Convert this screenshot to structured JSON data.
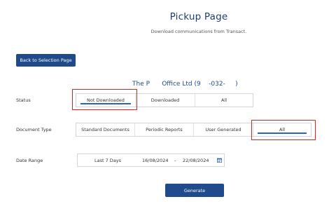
{
  "page": {
    "title": "Pickup Page",
    "subtitle": "Download communications from Transact."
  },
  "back_button": {
    "label": "Back to Selection Page"
  },
  "company": {
    "name": "The P      Office Ltd (9    -032-     )"
  },
  "status": {
    "label": "Status",
    "options": [
      "Not Downloaded",
      "Downloaded",
      "All"
    ],
    "selected": "Not Downloaded"
  },
  "document_type": {
    "label": "Document Type",
    "options": [
      "Standard Documents",
      "Periodic Reports",
      "User Generated",
      "All"
    ],
    "selected": "All"
  },
  "date_range": {
    "label": "Date Range",
    "preset": "Last 7 Days",
    "from": "16/08/2024",
    "separator": "-",
    "to": "22/08/2024"
  },
  "generate_button": {
    "label": "Generate"
  },
  "colors": {
    "primary": "#1f4a8c",
    "selected_underline": "#2d63b7",
    "highlight": "#e2231a"
  }
}
